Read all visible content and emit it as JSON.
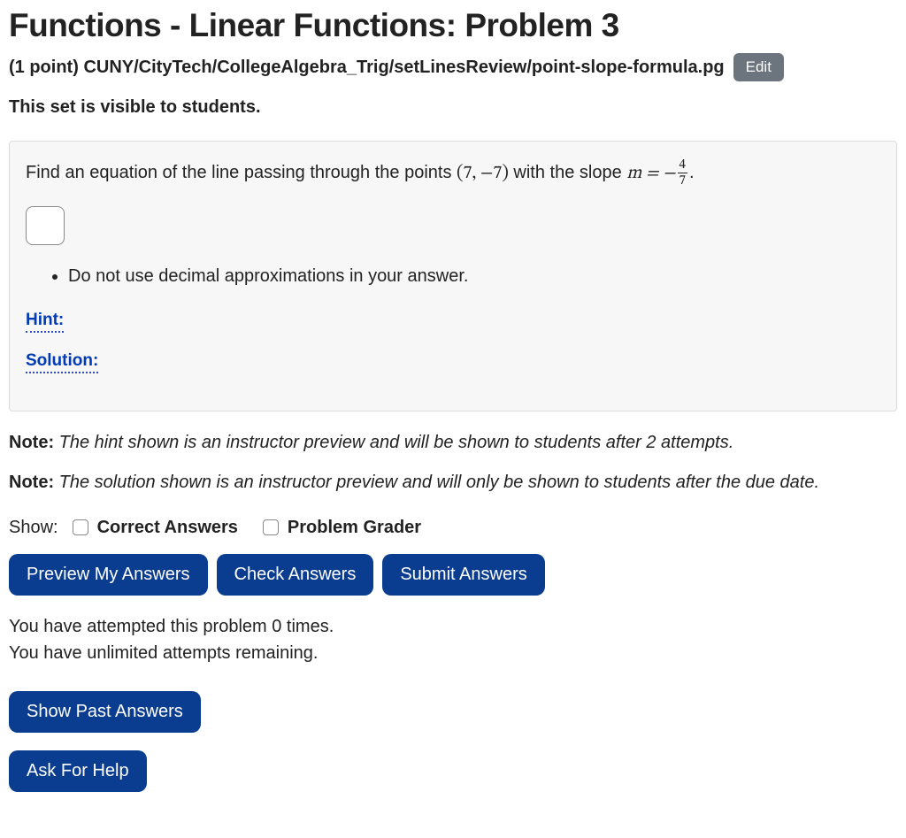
{
  "header": {
    "title": "Functions - Linear Functions: Problem 3",
    "points": "(1 point)",
    "path": "CUNY/CityTech/CollegeAlgebra_Trig/setLinesReview/point-slope-formula.pg",
    "edit_label": "Edit"
  },
  "visibility_text": "This set is visible to students.",
  "problem": {
    "prefix": "Find an equation of the line passing through the points ",
    "point_open": "(",
    "point_x": "7",
    "point_comma": ", ",
    "point_y": "−7",
    "point_close": ")",
    "mid": " with the slope ",
    "m_equals": "m = −",
    "frac_num": "4",
    "frac_den": "7",
    "suffix": ".",
    "instruction_item": "Do not use decimal approximations in your answer.",
    "hint_label": "Hint:",
    "solution_label": "Solution:"
  },
  "notes": {
    "label": "Note:",
    "hint_note": " The hint shown is an instructor preview and will be shown to students after 2 attempts.",
    "solution_note": " The solution shown is an instructor preview and will only be shown to students after the due date."
  },
  "show": {
    "label": "Show:",
    "correct_answers": "Correct Answers",
    "problem_grader": "Problem Grader"
  },
  "buttons": {
    "preview": "Preview My Answers",
    "check": "Check Answers",
    "submit": "Submit Answers",
    "show_past": "Show Past Answers",
    "ask_help": "Ask For Help"
  },
  "attempts": {
    "line1": "You have attempted this problem 0 times.",
    "line2": "You have unlimited attempts remaining."
  }
}
